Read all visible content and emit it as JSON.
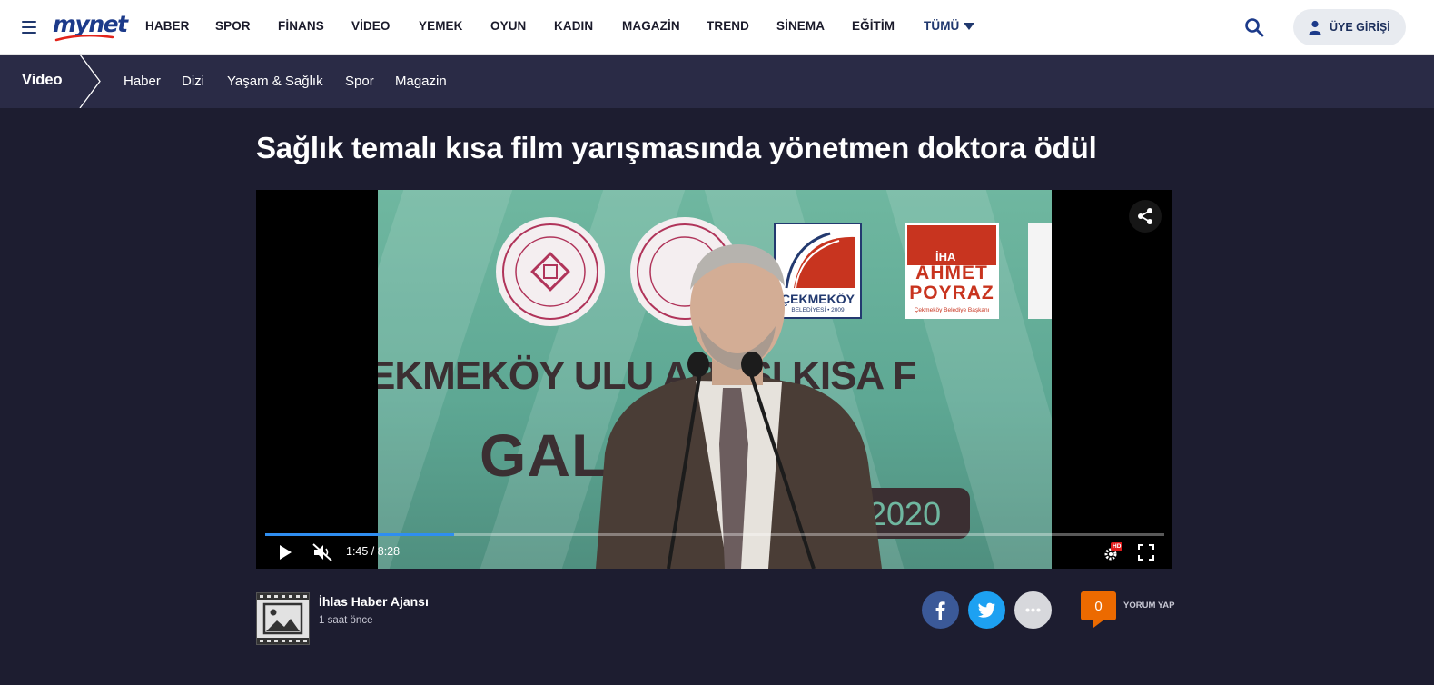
{
  "brand": {
    "logo_text": "mynet",
    "color": "#1c3a8a"
  },
  "nav": {
    "items": [
      "HABER",
      "SPOR",
      "FİNANS",
      "VİDEO",
      "YEMEK",
      "OYUN",
      "KADIN",
      "MAGAZİN",
      "TREND",
      "SİNEMA",
      "EĞİTİM",
      "TÜMÜ"
    ],
    "login_label": "ÜYE GİRİŞİ"
  },
  "subnav": {
    "section": "Video",
    "items": [
      "Haber",
      "Dizi",
      "Yaşam & Sağlık",
      "Spor",
      "Magazin"
    ]
  },
  "article": {
    "title": "Sağlık temalı kısa film yarışmasında yönetmen doktora ödül"
  },
  "player": {
    "current_time": "1:45",
    "duration": "8:28",
    "time_display": "1:45 / 8:28",
    "progress_fraction": 0.21,
    "muted": true,
    "hd_badge": "HD",
    "frame_sign_1": "EKMEKÖY ULU ARASI KISA F",
    "frame_sign_2": "GAL ÜL TÖR",
    "frame_sign_3": "2020",
    "frame_logo_1": "ÇEKMEKÖY",
    "frame_logo_1_sub": "BELEDİYESİ • 2009",
    "frame_logo_2a": "AHMET",
    "frame_logo_2b": "POYRAZ",
    "frame_logo_2_sub": "Çekmeköy Belediye Başkanı",
    "frame_watermark": "İHA"
  },
  "meta": {
    "author": "İhlas Haber Ajansı",
    "time_ago": "1 saat önce",
    "comment_count": "0",
    "comment_label": "YORUM YAP"
  },
  "colors": {
    "page_bg": "#1d1d30",
    "subnav_bg": "#2a2b46",
    "facebook": "#3b5998",
    "twitter": "#1da1f2",
    "more": "#d7d8dc",
    "comment": "#ec6a00",
    "progress": "#2f8ef0"
  }
}
